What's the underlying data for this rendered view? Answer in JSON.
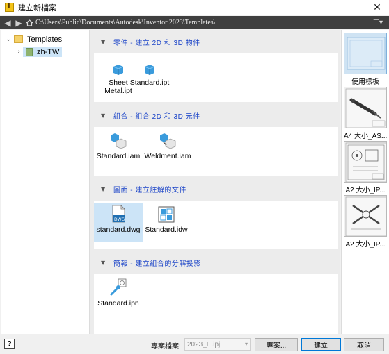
{
  "window": {
    "title": "建立新檔案",
    "close_glyph": "✕"
  },
  "address": {
    "back_glyph": "◀",
    "forward_glyph": "▶",
    "path": "C:\\Users\\Public\\Documents\\Autodesk\\Inventor 2023\\Templates\\",
    "view_glyph": "☰▾"
  },
  "tree": {
    "root_label": "Templates",
    "child_label": "zh-TW",
    "root_chevron": "⌄",
    "child_chevron": "›"
  },
  "sections": [
    {
      "title": "零件 - 建立 2D 和 3D 物件",
      "arrow": "▼",
      "items": [
        {
          "label_line1": "Sheet",
          "label_line2": "Metal.ipt",
          "icon": "sheetmetal-part-icon"
        },
        {
          "label_line1": "Standard.ipt",
          "label_line2": "",
          "icon": "part-icon"
        }
      ]
    },
    {
      "title": "組合 - 組合 2D 和 3D 元件",
      "arrow": "▼",
      "items": [
        {
          "label_line1": "Standard.iam",
          "icon": "assembly-icon"
        },
        {
          "label_line1": "Weldment.iam",
          "icon": "weldment-icon"
        }
      ]
    },
    {
      "title": "圖面 - 建立註解的文件",
      "arrow": "▼",
      "items": [
        {
          "label_line1": "standard.dwg",
          "icon": "dwg-drawing-icon",
          "icon_text": "DWG",
          "selected": true
        },
        {
          "label_line1": "Standard.idw",
          "icon": "idw-drawing-icon"
        }
      ]
    },
    {
      "title": "簡報 - 建立組合的分解投影",
      "arrow": "▼",
      "items": [
        {
          "label_line1": "Standard.ipn",
          "icon": "presentation-icon"
        }
      ]
    }
  ],
  "templates_strip": [
    {
      "label": "使用樣板",
      "selected": true
    },
    {
      "label": "A4 大小_AS..."
    },
    {
      "label": "A2 大小_IP..."
    },
    {
      "label": "A2 大小_IP..."
    }
  ],
  "footer": {
    "help_label": "?",
    "project_label": "專案檔案:",
    "project_value": "2023_E.ipj",
    "project_caret": "▾",
    "projects_button": "專案...",
    "create_button": "建立",
    "cancel_button": "取消"
  },
  "colors": {
    "section_title": "#1b44c8",
    "selection": "#cce4f7",
    "address_bar": "#3f3f3f",
    "primary_border": "#0078d7"
  }
}
